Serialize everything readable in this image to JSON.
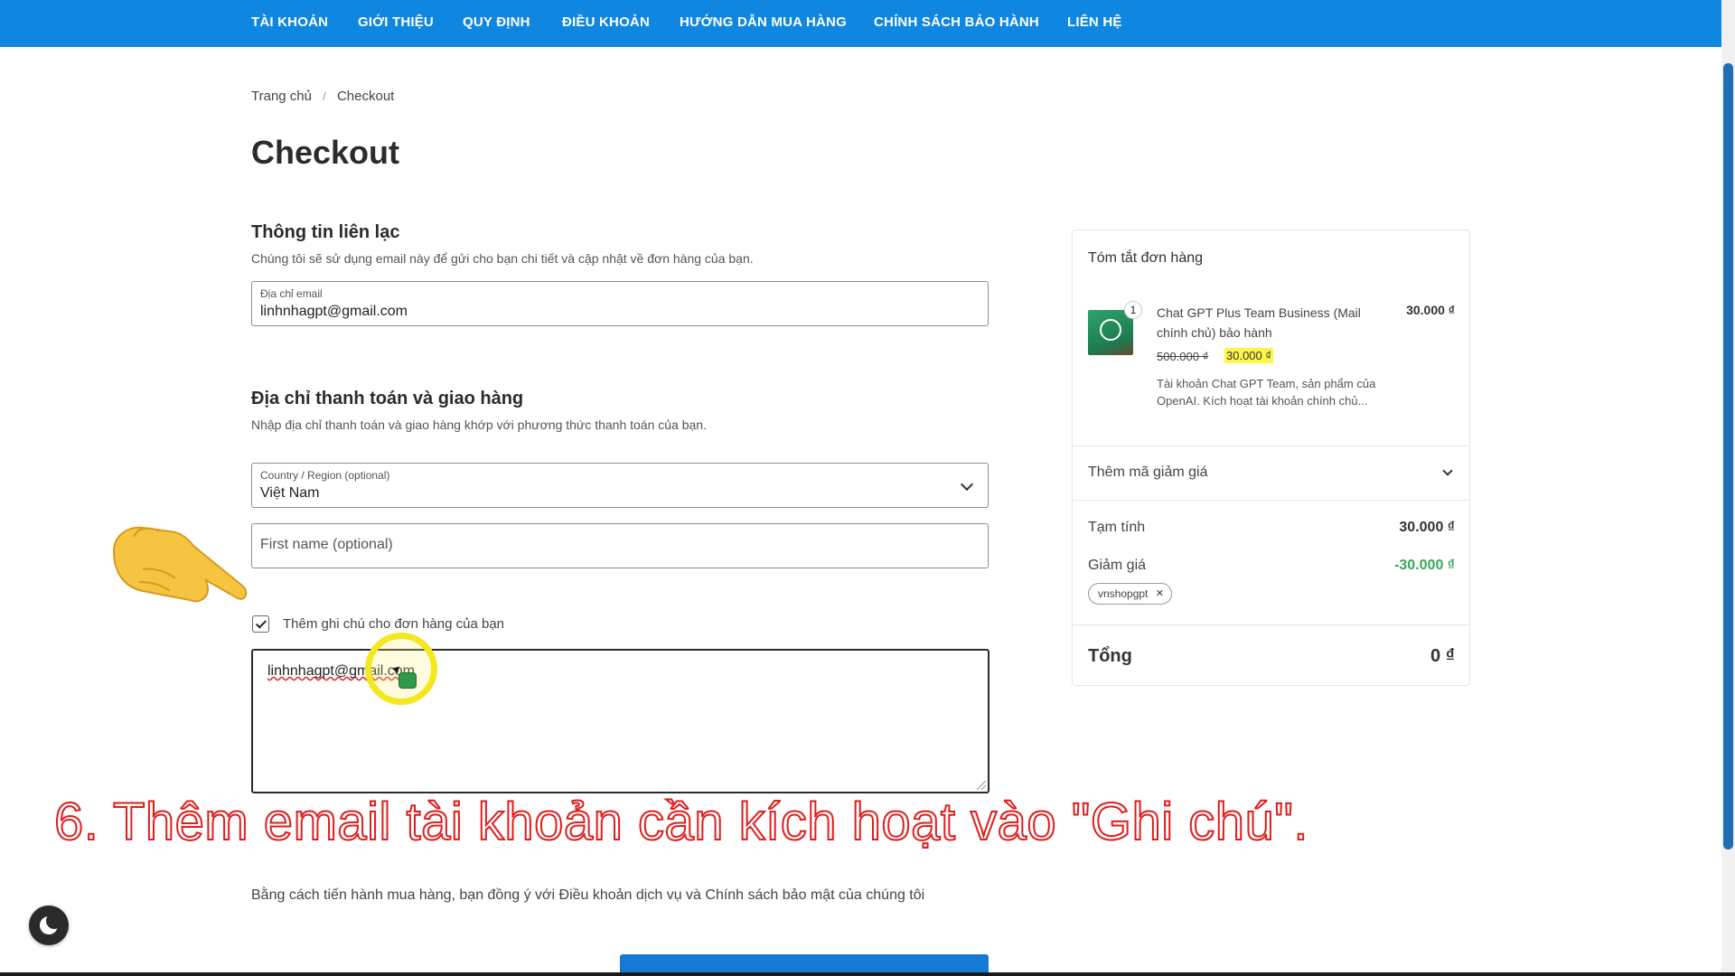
{
  "nav": {
    "items": [
      "TÀI KHOẢN",
      "GIỚI THIỆU",
      "QUY ĐỊNH",
      "ĐIỀU KHOẢN",
      "HƯỚNG DẪN MUA HÀNG",
      "CHÍNH SÁCH BẢO HÀNH",
      "LIÊN HỆ"
    ]
  },
  "breadcrumb": {
    "home": "Trang chủ",
    "separator": "/",
    "current": "Checkout"
  },
  "page_title": "Checkout",
  "contact": {
    "title": "Thông tin liên lạc",
    "description": "Chúng tôi sẽ sử dụng email này để gửi cho bạn chi tiết và cập nhật về đơn hàng của bạn.",
    "email_label": "Địa chỉ email",
    "email_value": "linhnhagpt@gmail.com"
  },
  "address": {
    "title": "Địa chỉ thanh toán và giao hàng",
    "description": "Nhập địa chỉ thanh toán và giao hàng khớp với phương thức thanh toán của bạn.",
    "country_label": "Country / Region (optional)",
    "country_value": "Việt Nam",
    "first_name_placeholder": "First name (optional)"
  },
  "notes": {
    "checkbox_label": "Thêm ghi chú cho đơn hàng của bạn",
    "checked": true,
    "value": "linhnhagpt@gmail.com"
  },
  "caption": "6. Thêm email tài khoản cần kích hoạt vào \"Ghi chú\".",
  "terms": "Bằng cách tiến hành mua hàng, bạn đồng ý với Điều khoản dịch vụ và Chính sách bảo mật của chúng tôi",
  "summary": {
    "title": "Tóm tắt đơn hàng",
    "product": {
      "quantity": "1",
      "name": "Chat GPT Plus Team Business (Mail chính chủ) bảo hành",
      "price": "30.000 ₫",
      "old_price": "500.000 ₫",
      "new_price": "30.000 ₫",
      "description": "Tài khoản Chat GPT Team, sản phẩm của OpenAI. Kích hoạt tài khoản chính chủ..."
    },
    "coupon_label": "Thêm mã giảm giá",
    "subtotal_label": "Tạm tính",
    "subtotal_value": "30.000 ₫",
    "discount_label": "Giảm giá",
    "discount_value": "-30.000 ₫",
    "coupon_code": "vnshopgpt",
    "total_label": "Tổng",
    "total_value": "0 ₫"
  },
  "colors": {
    "nav_bg": "#0f86e0",
    "discount_green": "#3aa657",
    "price_highlight": "#fff54a",
    "caption_outline": "#e21b1b"
  }
}
